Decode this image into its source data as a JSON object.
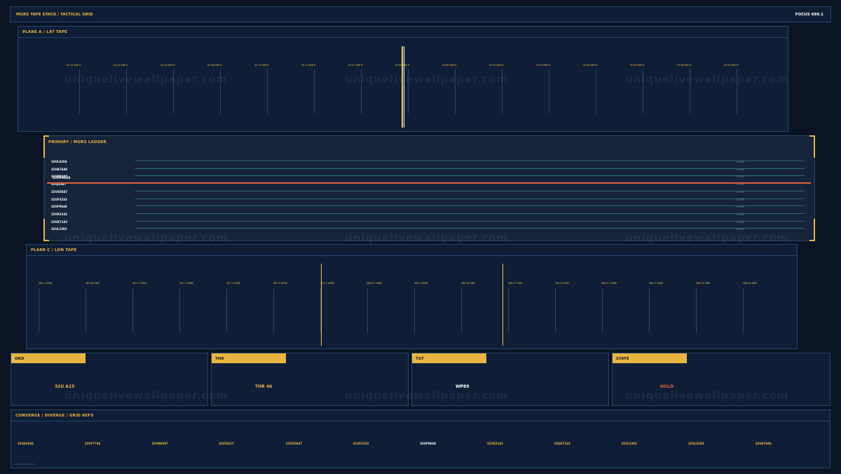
{
  "header": {
    "title": "MGRS TAPE STACK  /  TACTICAL GRID",
    "focus": "FOCUS 699.1"
  },
  "plane_a": {
    "title": "PLANE A  /  LAT TAPE",
    "ticks": [
      "34.2A 888 N",
      "34.2Z 888 N",
      "34.24 888 N",
      "34.1B 888 N",
      "34.15 888 N",
      "34.14 888 N",
      "34.1C 888 N",
      "34.09 888 N",
      "34.08 888 N",
      "34.05 888 N",
      "34.03 888 N",
      "34.00 888 N",
      "33.99 888 N",
      "33.98 888 N",
      "34.94 888 N"
    ]
  },
  "primary": {
    "title": "PRIMARY  /  MGRS LADDER",
    "current": "32UF9648",
    "rows": [
      {
        "label": "32UL4284",
        "value": "2.3286"
      },
      {
        "label": "32UA7648",
        "value": "2.4386"
      },
      {
        "label": "32UN8397",
        "value": "2.5026"
      },
      {
        "label": "32UJ2847",
        "value": "2.5556"
      },
      {
        "label": "32UG5847",
        "value": "2.6726"
      },
      {
        "label": "32UF3233",
        "value": "2.4706"
      },
      {
        "label": "32UF9648",
        "value": "2.4006"
      },
      {
        "label": "32UK3142",
        "value": "2.5536"
      },
      {
        "label": "32UK7143",
        "value": "2.5536"
      },
      {
        "label": "32UL2392",
        "value": "2.5026"
      }
    ]
  },
  "plane_c": {
    "title": "PLANE C  /  LON TAPE",
    "ticks": [
      "384.1 5MRE",
      "387.86 MRE",
      "387.7 1MRE",
      "387.2 6MRE",
      "387.9 2MRE",
      "387.9 6MRE",
      "387.9 4MRE",
      "389.87 2MRE",
      "382.2 6MRE",
      "386.36 MRE",
      "386.37 MRE",
      "389.26 MRE",
      "389.91 2MRE",
      "389.2 1MRE",
      "386.78 MRE",
      "386.96 MRE"
    ]
  },
  "cards": [
    {
      "tab": "ORD",
      "value": "32U A15",
      "color": "#e8b640"
    },
    {
      "tab": "THR",
      "value": "THR 46",
      "color": "#e8b640"
    },
    {
      "tab": "TGT",
      "value": "WP89",
      "color": "#ffffff"
    },
    {
      "tab": "STATE",
      "value": "HOLD",
      "color": "#e0603c"
    }
  ],
  "converge": {
    "title": "CONVERGE / DIVERGE  /  GRID REFS",
    "refs": [
      "32UA2646",
      "32UF7746",
      "32UN8397",
      "32UI5427",
      "32UG5847",
      "32UF3233",
      "32UF9648",
      "32UK3142",
      "32UK7143",
      "32UL2392",
      "32UL4284",
      "32UA7648"
    ],
    "footnote": "MARK TAB / DIRECTS"
  },
  "watermark": "uniquelivewallpaper.com",
  "colors": {
    "accent": "#e8b640",
    "alert": "#e0603c",
    "panel": "#0f1e36",
    "border": "#26456e"
  }
}
